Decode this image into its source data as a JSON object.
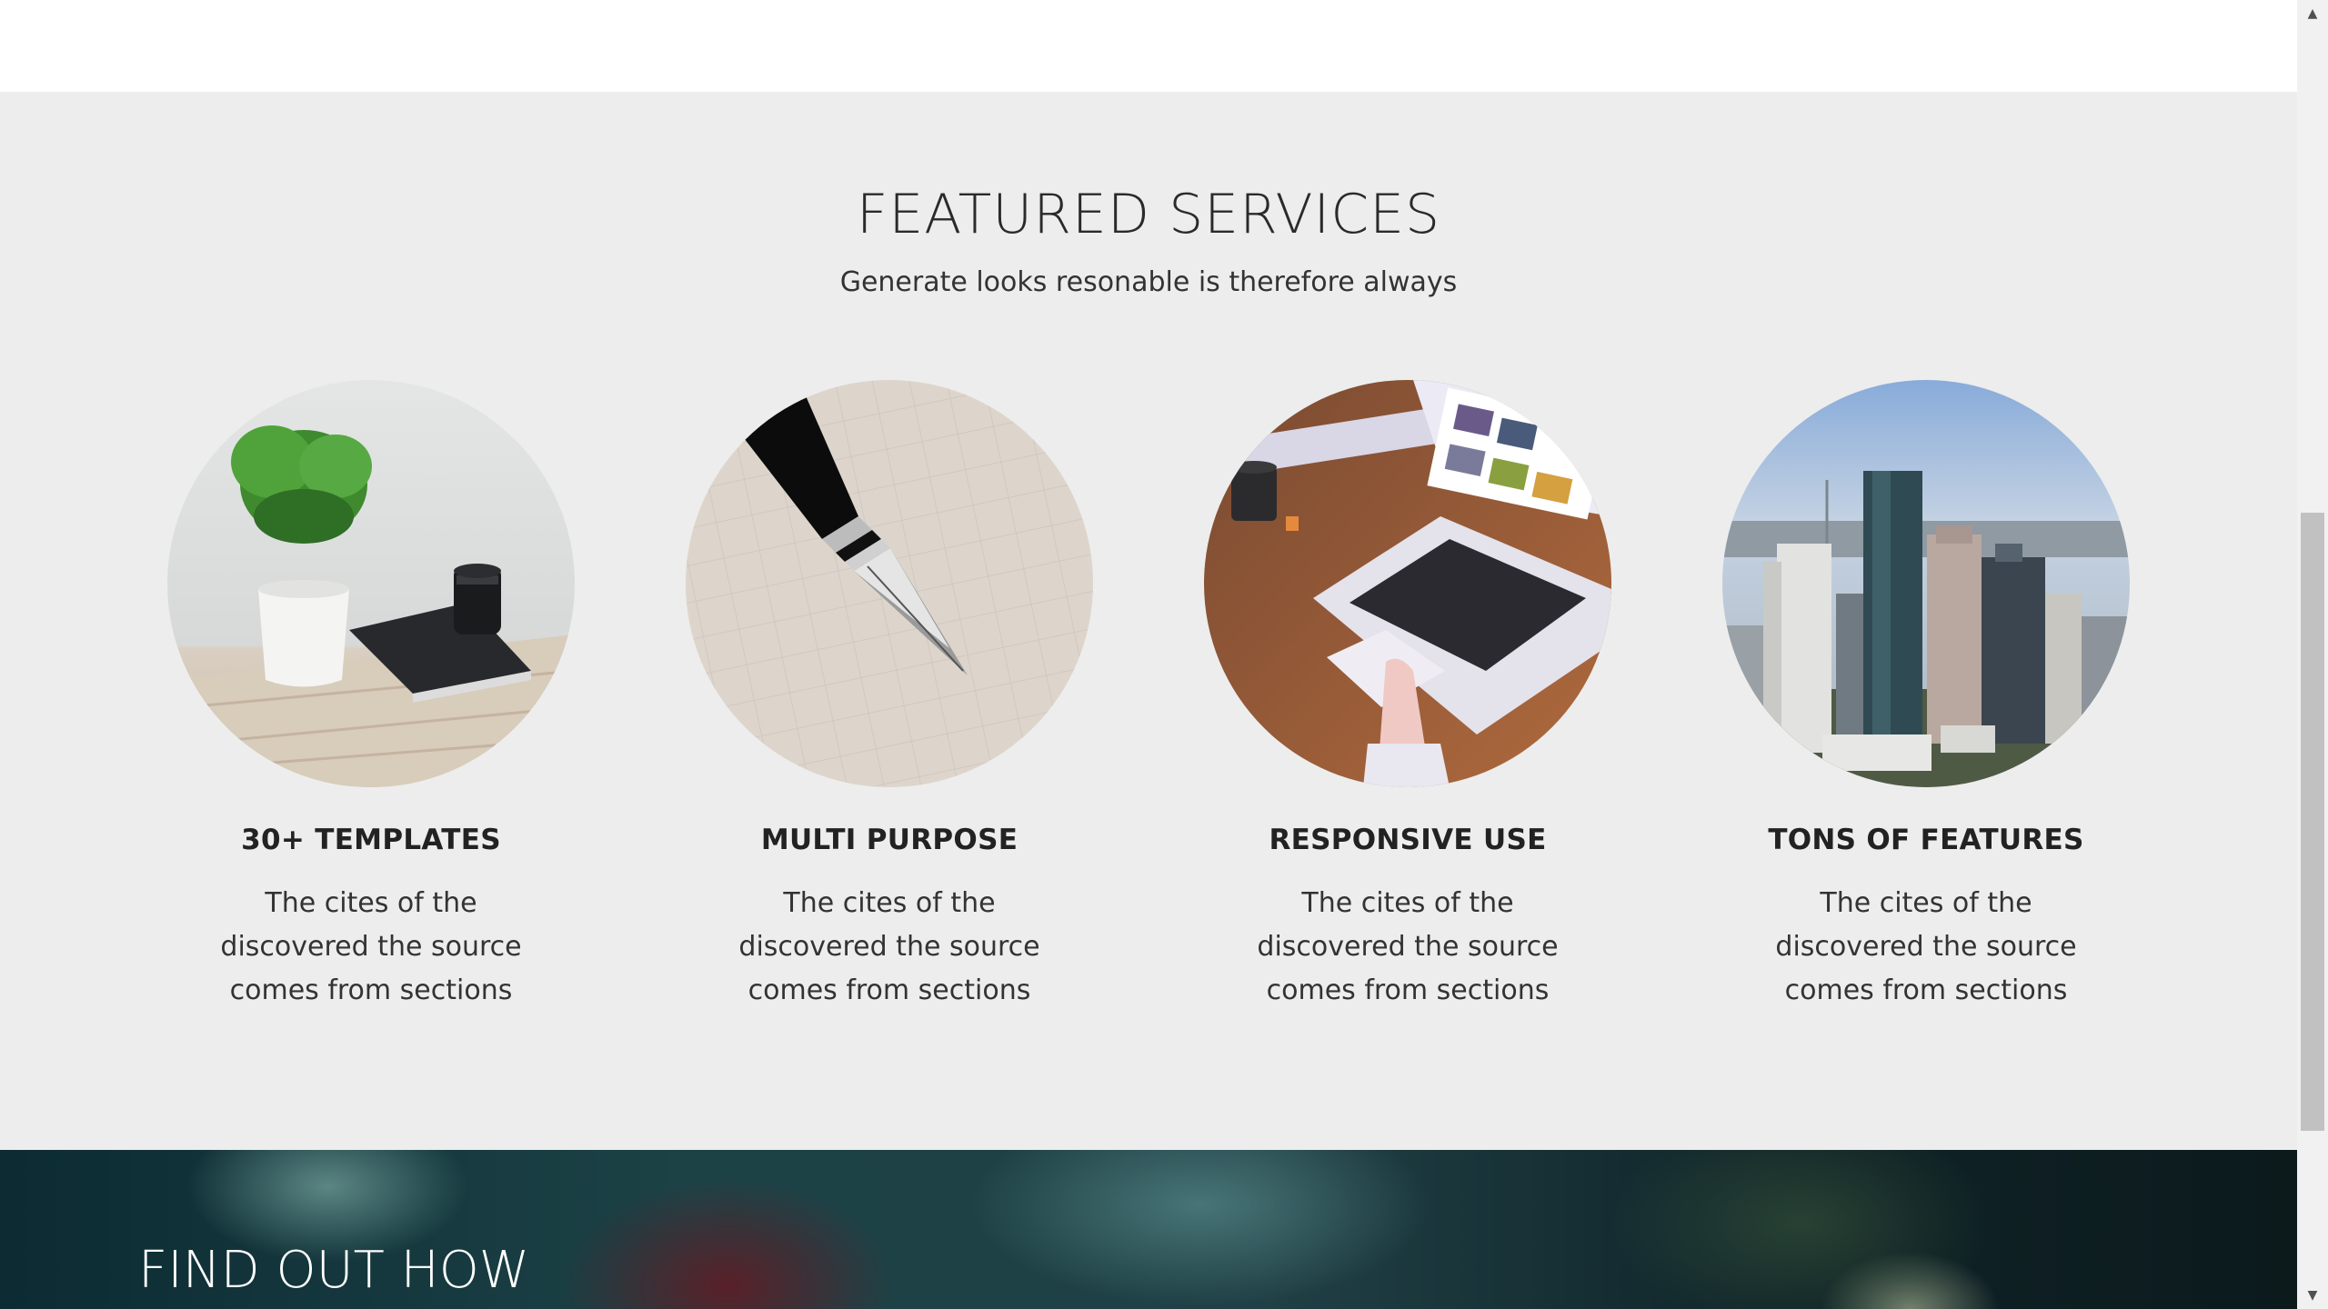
{
  "services_section": {
    "title": "FEATURED SERVICES",
    "subtitle": "Generate looks resonable is therefore always"
  },
  "cards": [
    {
      "title": "30+ TEMPLATES",
      "text": "The cites of the discovered the source comes from sections",
      "image": "plant-and-camera-photo"
    },
    {
      "title": "MULTI PURPOSE",
      "text": "The cites of the discovered the source comes from sections",
      "image": "fountain-pen-photo"
    },
    {
      "title": "RESPONSIVE USE",
      "text": "The cites of the discovered the source comes from sections",
      "image": "laptop-photo"
    },
    {
      "title": "TONS OF FEATURES",
      "text": "The cites of the discovered the source comes from sections",
      "image": "city-skyline-photo"
    }
  ],
  "hero": {
    "title": "FIND OUT HOW"
  },
  "scrollbar": {
    "up_icon": "chevron-up-icon",
    "down_icon": "chevron-down-icon"
  },
  "colors": {
    "section_background": "#ededed",
    "text": "#333333",
    "heading": "#222222"
  }
}
